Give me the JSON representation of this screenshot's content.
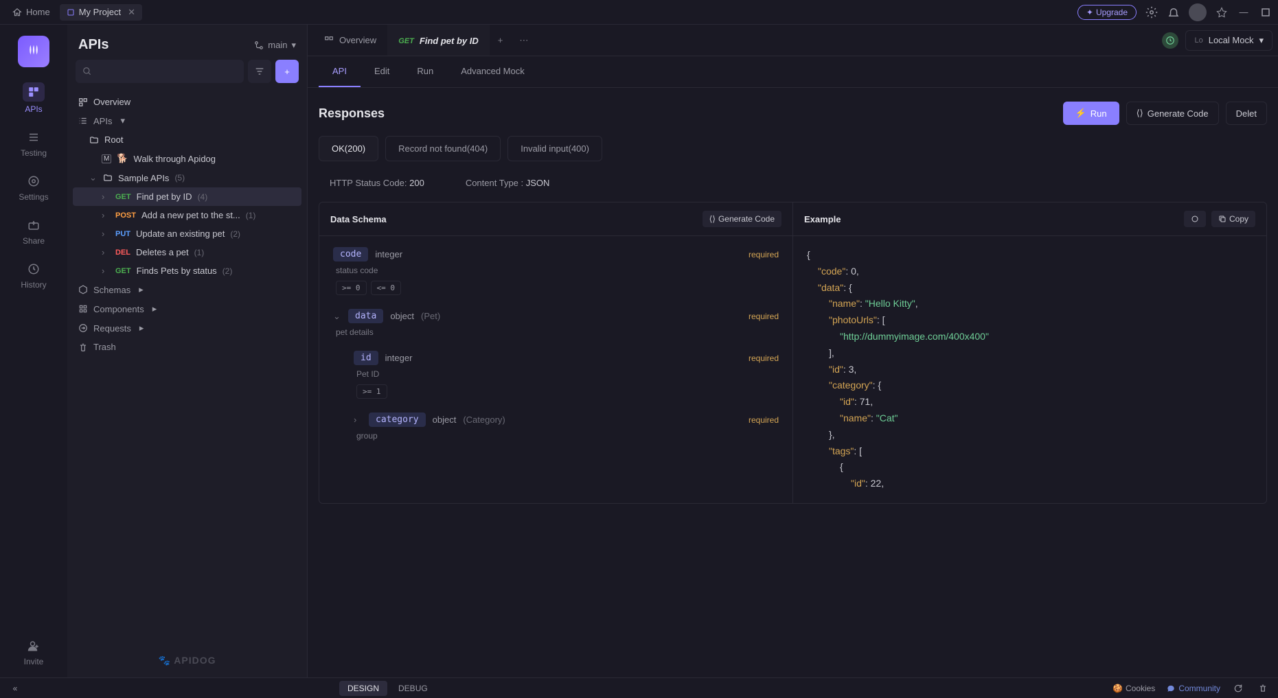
{
  "titlebar": {
    "home": "Home",
    "project": "My Project",
    "upgrade": "Upgrade"
  },
  "rail": {
    "apis": "APIs",
    "testing": "Testing",
    "settings": "Settings",
    "share": "Share",
    "history": "History",
    "invite": "Invite"
  },
  "sidebar": {
    "title": "APIs",
    "branch": "main",
    "overview": "Overview",
    "apis_section": "APIs",
    "root": "Root",
    "walkthrough": "Walk through Apidog",
    "sample_apis": "Sample APIs",
    "sample_apis_count": "(5)",
    "items": [
      {
        "method": "GET",
        "name": "Find pet by ID",
        "count": "(4)"
      },
      {
        "method": "POST",
        "name": "Add a new pet to the st...",
        "count": "(1)"
      },
      {
        "method": "PUT",
        "name": "Update an existing pet",
        "count": "(2)"
      },
      {
        "method": "DEL",
        "name": "Deletes a pet",
        "count": "(1)"
      },
      {
        "method": "GET",
        "name": "Finds Pets by status",
        "count": "(2)"
      }
    ],
    "schemas": "Schemas",
    "components": "Components",
    "requests": "Requests",
    "trash": "Trash",
    "footer": "APIDOG"
  },
  "tabs": {
    "overview": "Overview",
    "active_method": "GET",
    "active_name": "Find pet by ID"
  },
  "env": {
    "short": "Lo",
    "name": "Local Mock"
  },
  "subtabs": {
    "api": "API",
    "edit": "Edit",
    "run": "Run",
    "mock": "Advanced Mock"
  },
  "responses": {
    "title": "Responses",
    "run": "Run",
    "gencode": "Generate Code",
    "delete": "Delet",
    "tabs": [
      {
        "label": "OK(200)"
      },
      {
        "label": "Record not found(404)"
      },
      {
        "label": "Invalid input(400)"
      }
    ],
    "http_label": "HTTP Status Code:",
    "http_value": "200",
    "ct_label": "Content Type :",
    "ct_value": "JSON"
  },
  "schema": {
    "title": "Data Schema",
    "gencode": "Generate Code",
    "fields": {
      "code": {
        "name": "code",
        "type": "integer",
        "req": "required",
        "desc": "status code",
        "c1": ">= 0",
        "c2": "<= 0"
      },
      "data": {
        "name": "data",
        "type": "object",
        "ref": "(Pet)",
        "req": "required",
        "desc": "pet details"
      },
      "id": {
        "name": "id",
        "type": "integer",
        "req": "required",
        "desc": "Pet ID",
        "c1": ">= 1"
      },
      "category": {
        "name": "category",
        "type": "object",
        "ref": "(Category)",
        "req": "required",
        "desc": "group"
      }
    }
  },
  "example": {
    "title": "Example",
    "copy": "Copy"
  },
  "json_example": {
    "l1": "{",
    "l2a": "\"code\"",
    "l2b": ": ",
    "l2c": "0",
    "l2d": ",",
    "l3a": "\"data\"",
    "l3b": ": {",
    "l4a": "\"name\"",
    "l4b": ": ",
    "l4c": "\"Hello Kitty\"",
    "l4d": ",",
    "l5a": "\"photoUrls\"",
    "l5b": ": [",
    "l6": "\"http://dummyimage.com/400x400\"",
    "l7": "],",
    "l8a": "\"id\"",
    "l8b": ": ",
    "l8c": "3",
    "l8d": ",",
    "l9a": "\"category\"",
    "l9b": ": {",
    "l10a": "\"id\"",
    "l10b": ": ",
    "l10c": "71",
    "l10d": ",",
    "l11a": "\"name\"",
    "l11b": ": ",
    "l11c": "\"Cat\"",
    "l12": "},",
    "l13a": "\"tags\"",
    "l13b": ": [",
    "l14": "{",
    "l15a": "\"id\"",
    "l15b": ": ",
    "l15c": "22",
    "l15d": ","
  },
  "bottom": {
    "design": "DESIGN",
    "debug": "DEBUG",
    "cookies": "Cookies",
    "community": "Community"
  }
}
